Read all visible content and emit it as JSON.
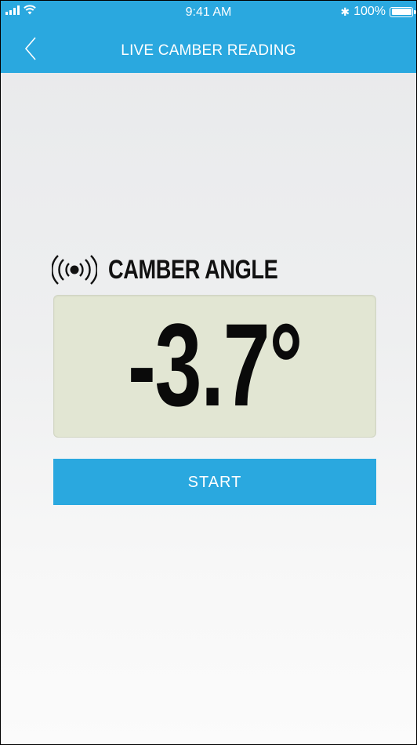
{
  "status_bar": {
    "time": "9:41 AM",
    "battery_text": "100%",
    "battery_level": 1.0,
    "bluetooth_glyph": "✱",
    "icons": [
      "signal-icon",
      "wifi-icon",
      "bluetooth-icon",
      "battery-icon"
    ]
  },
  "nav": {
    "title": "LIVE CAMBER READING",
    "back_icon": "chevron-left-icon"
  },
  "reading": {
    "label": "CAMBER ANGLE",
    "value": "-3.7°",
    "icon": "broadcast-icon"
  },
  "start_button": {
    "label": "START"
  },
  "colors": {
    "accent": "#2aa8df",
    "display_bg": "#e2e6d3",
    "text_dark": "#111111",
    "white": "#ffffff"
  }
}
